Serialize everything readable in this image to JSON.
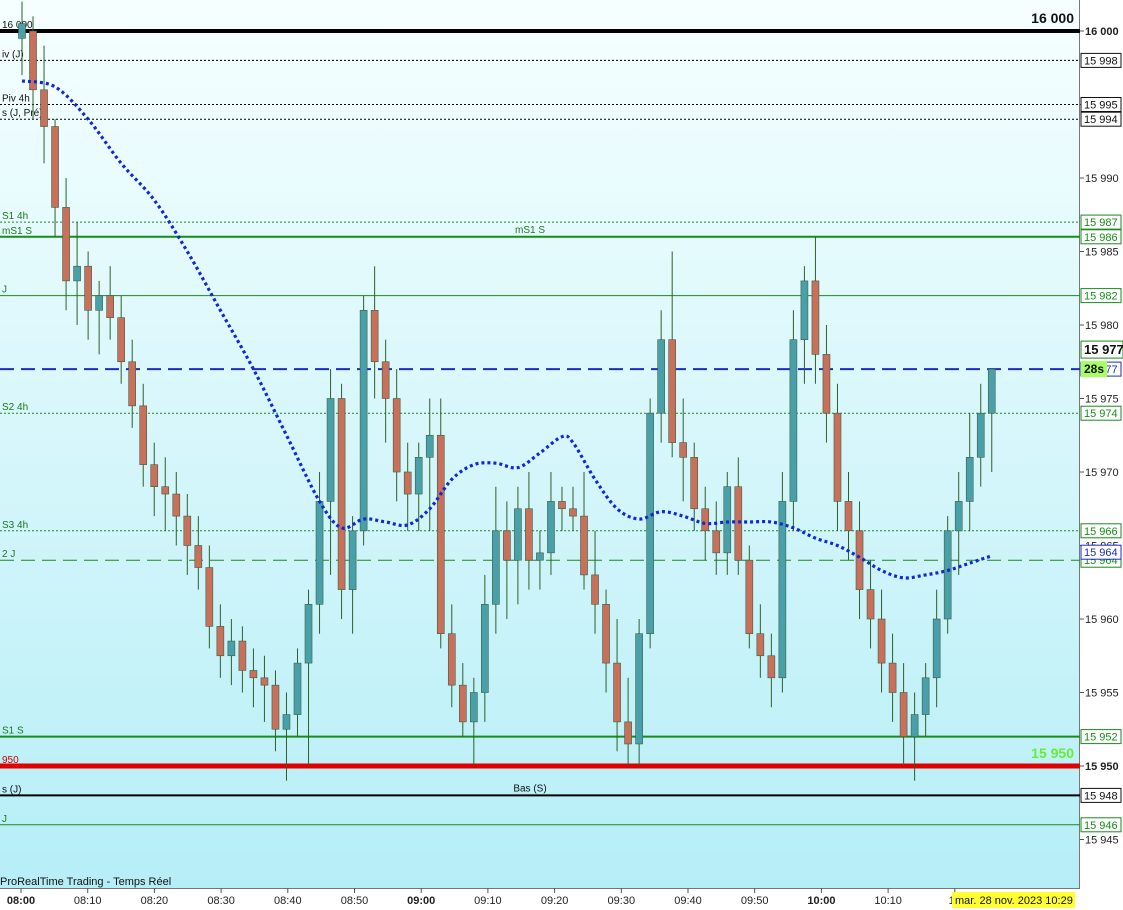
{
  "chart_data": {
    "type": "candlestick",
    "watermark": "ProRealTime Trading - Temps Réel",
    "date_stamp": "mar. 28 nov. 2023 10:29",
    "countdown": "28s",
    "ylim": [
      15941,
      16002
    ],
    "x_ticks": [
      {
        "label": "08:00",
        "bold": true
      },
      {
        "label": "08:10"
      },
      {
        "label": "08:20"
      },
      {
        "label": "08:30"
      },
      {
        "label": "08:40"
      },
      {
        "label": "08:50"
      },
      {
        "label": "09:00",
        "bold": true
      },
      {
        "label": "09:10"
      },
      {
        "label": "09:20"
      },
      {
        "label": "09:30"
      },
      {
        "label": "09:40"
      },
      {
        "label": "09:50"
      },
      {
        "label": "10:00",
        "bold": true
      },
      {
        "label": "10:10"
      },
      {
        "label": "10"
      }
    ],
    "y_ticks": [
      "15 945",
      "15 950",
      "15 955",
      "15 960",
      "15 965",
      "15 970",
      "15 975",
      "15 980",
      "15 985",
      "15 990",
      "15 995",
      "16 000"
    ],
    "y_tick_values": [
      15945,
      15950,
      15955,
      15960,
      15965,
      15970,
      15975,
      15980,
      15985,
      15990,
      15995,
      16000
    ],
    "levels": [
      {
        "value": 16000,
        "label": "16 000",
        "color": "#000000",
        "badge": "16 000",
        "big_label": "16 000",
        "style": "solid",
        "weight": 4
      },
      {
        "value": 15998,
        "label": "iv (J)",
        "color": "#000000",
        "badge": "15 998",
        "style": "dotted",
        "weight": 1
      },
      {
        "value": 15995,
        "label": "Piv 4h",
        "color": "#000000",
        "badge": "15 995",
        "style": "dotted",
        "weight": 1
      },
      {
        "value": 15994,
        "label": "s (J, Pré)",
        "color": "#000000",
        "badge": "15 994",
        "style": "dotted",
        "weight": 1
      },
      {
        "value": 15987,
        "label": "S1 4h",
        "color": "#1a8a1a",
        "badge": "15 987",
        "style": "dotted",
        "weight": 1
      },
      {
        "value": 15986,
        "label": "mS1 S",
        "color": "#1a8a1a",
        "badge": "15 986",
        "style": "solid",
        "weight": 2
      },
      {
        "value": 15982,
        "label": "J",
        "color": "#1a8a1a",
        "badge": "15 982",
        "style": "solid",
        "weight": 1
      },
      {
        "value": 15977,
        "label": "",
        "color": "#1a2ec0",
        "badge": "15 977",
        "style": "dashed",
        "weight": 2
      },
      {
        "value": 15974,
        "label": "S2 4h",
        "color": "#1a8a1a",
        "badge": "15 974",
        "style": "dotted",
        "weight": 1
      },
      {
        "value": 15966,
        "label": "S3 4h",
        "color": "#1a8a1a",
        "badge": "15 966",
        "style": "dotted",
        "weight": 1
      },
      {
        "value": 15964,
        "label": "2 J",
        "color": "#1a8a1a",
        "badge": "15 964",
        "style": "dashed",
        "weight": 1
      },
      {
        "value": 15952,
        "label": "S1 S",
        "color": "#1a8a1a",
        "badge": "15 952",
        "style": "solid",
        "weight": 2
      },
      {
        "value": 15950,
        "label": "950",
        "color": "#e00000",
        "badge": "15 950",
        "big_label": "15 950",
        "style": "solid",
        "weight": 5
      },
      {
        "value": 15948,
        "label": "s (J)",
        "color": "#000000",
        "badge": "15 948",
        "style": "solid",
        "weight": 2
      },
      {
        "value": 15946,
        "label": "J",
        "color": "#1a8a1a",
        "badge": "15 946",
        "style": "solid",
        "weight": 1
      }
    ],
    "extra_labels": [
      {
        "text": "Bas (S)",
        "value": 15948
      },
      {
        "text": "mS1 S",
        "value": 15986
      }
    ],
    "current_price": {
      "value": 15977,
      "label": "15 977"
    },
    "ma_badge": {
      "value": 15964,
      "label": "15 964"
    },
    "candles": [
      {
        "o": 15999.5,
        "h": 16002,
        "l": 15997,
        "c": 16000.5
      },
      {
        "o": 16000,
        "h": 16001,
        "l": 15994,
        "c": 15996
      },
      {
        "o": 15996,
        "h": 15999,
        "l": 15991,
        "c": 15993.5
      },
      {
        "o": 15993.5,
        "h": 15994,
        "l": 15986,
        "c": 15988
      },
      {
        "o": 15988,
        "h": 15990,
        "l": 15981,
        "c": 15983
      },
      {
        "o": 15983,
        "h": 15987,
        "l": 15980,
        "c": 15984
      },
      {
        "o": 15984,
        "h": 15985,
        "l": 15979,
        "c": 15981
      },
      {
        "o": 15981,
        "h": 15983,
        "l": 15978,
        "c": 15982
      },
      {
        "o": 15982,
        "h": 15984,
        "l": 15979,
        "c": 15980.5
      },
      {
        "o": 15980.5,
        "h": 15982,
        "l": 15976,
        "c": 15977.5
      },
      {
        "o": 15977.5,
        "h": 15979,
        "l": 15973,
        "c": 15974.5
      },
      {
        "o": 15974.5,
        "h": 15976,
        "l": 15969,
        "c": 15970.5
      },
      {
        "o": 15970.5,
        "h": 15972,
        "l": 15967,
        "c": 15969
      },
      {
        "o": 15969,
        "h": 15971,
        "l": 15966,
        "c": 15968.5
      },
      {
        "o": 15968.5,
        "h": 15970,
        "l": 15965,
        "c": 15967
      },
      {
        "o": 15967,
        "h": 15968.5,
        "l": 15963,
        "c": 15965
      },
      {
        "o": 15965,
        "h": 15967,
        "l": 15962,
        "c": 15963.5
      },
      {
        "o": 15963.5,
        "h": 15965,
        "l": 15958,
        "c": 15959.5
      },
      {
        "o": 15959.5,
        "h": 15961,
        "l": 15956,
        "c": 15957.5
      },
      {
        "o": 15957.5,
        "h": 15960,
        "l": 15955.5,
        "c": 15958.5
      },
      {
        "o": 15958.5,
        "h": 15959.5,
        "l": 15955,
        "c": 15956.5
      },
      {
        "o": 15956.5,
        "h": 15958,
        "l": 15954,
        "c": 15956
      },
      {
        "o": 15956,
        "h": 15957.5,
        "l": 15953,
        "c": 15955.5
      },
      {
        "o": 15955.5,
        "h": 15956.5,
        "l": 15951,
        "c": 15952.5
      },
      {
        "o": 15952.5,
        "h": 15955,
        "l": 15949,
        "c": 15953.5
      },
      {
        "o": 15953.5,
        "h": 15958,
        "l": 15952,
        "c": 15957
      },
      {
        "o": 15957,
        "h": 15962,
        "l": 15950,
        "c": 15961
      },
      {
        "o": 15961,
        "h": 15970,
        "l": 15959,
        "c": 15968
      },
      {
        "o": 15968,
        "h": 15977,
        "l": 15963,
        "c": 15975
      },
      {
        "o": 15975,
        "h": 15976,
        "l": 15960,
        "c": 15962
      },
      {
        "o": 15962,
        "h": 15967,
        "l": 15959,
        "c": 15966
      },
      {
        "o": 15966,
        "h": 15982,
        "l": 15965,
        "c": 15981
      },
      {
        "o": 15981,
        "h": 15984,
        "l": 15975,
        "c": 15977.5
      },
      {
        "o": 15977.5,
        "h": 15979,
        "l": 15972,
        "c": 15975
      },
      {
        "o": 15975,
        "h": 15977,
        "l": 15968,
        "c": 15970
      },
      {
        "o": 15970,
        "h": 15972,
        "l": 15966,
        "c": 15968.5
      },
      {
        "o": 15968.5,
        "h": 15972,
        "l": 15966,
        "c": 15971
      },
      {
        "o": 15971,
        "h": 15975,
        "l": 15966,
        "c": 15972.5
      },
      {
        "o": 15972.5,
        "h": 15975,
        "l": 15958,
        "c": 15959
      },
      {
        "o": 15959,
        "h": 15961,
        "l": 15954,
        "c": 15955.5
      },
      {
        "o": 15955.5,
        "h": 15957,
        "l": 15952,
        "c": 15953
      },
      {
        "o": 15953,
        "h": 15956,
        "l": 15950,
        "c": 15955
      },
      {
        "o": 15955,
        "h": 15963,
        "l": 15953,
        "c": 15961
      },
      {
        "o": 15961,
        "h": 15969,
        "l": 15959,
        "c": 15966
      },
      {
        "o": 15966,
        "h": 15968,
        "l": 15960,
        "c": 15964
      },
      {
        "o": 15964,
        "h": 15969,
        "l": 15961,
        "c": 15967.5
      },
      {
        "o": 15967.5,
        "h": 15970,
        "l": 15962,
        "c": 15964
      },
      {
        "o": 15964,
        "h": 15966,
        "l": 15962,
        "c": 15964.5
      },
      {
        "o": 15964.5,
        "h": 15970,
        "l": 15963,
        "c": 15968
      },
      {
        "o": 15968,
        "h": 15969,
        "l": 15966,
        "c": 15967.5
      },
      {
        "o": 15967.5,
        "h": 15969,
        "l": 15966,
        "c": 15967
      },
      {
        "o": 15967,
        "h": 15970,
        "l": 15962,
        "c": 15963
      },
      {
        "o": 15963,
        "h": 15966,
        "l": 15959,
        "c": 15961
      },
      {
        "o": 15961,
        "h": 15962,
        "l": 15955,
        "c": 15957
      },
      {
        "o": 15957,
        "h": 15960,
        "l": 15951,
        "c": 15953
      },
      {
        "o": 15953,
        "h": 15956,
        "l": 15950,
        "c": 15951.5
      },
      {
        "o": 15951.5,
        "h": 15960,
        "l": 15950,
        "c": 15959
      },
      {
        "o": 15959,
        "h": 15975,
        "l": 15958,
        "c": 15974
      },
      {
        "o": 15974,
        "h": 15981,
        "l": 15972,
        "c": 15979
      },
      {
        "o": 15979,
        "h": 15985,
        "l": 15971,
        "c": 15972
      },
      {
        "o": 15972,
        "h": 15975,
        "l": 15968,
        "c": 15971
      },
      {
        "o": 15971,
        "h": 15972,
        "l": 15966,
        "c": 15967.5
      },
      {
        "o": 15967.5,
        "h": 15969,
        "l": 15964,
        "c": 15966
      },
      {
        "o": 15966,
        "h": 15968,
        "l": 15963,
        "c": 15964.5
      },
      {
        "o": 15964.5,
        "h": 15970,
        "l": 15963,
        "c": 15969
      },
      {
        "o": 15969,
        "h": 15971,
        "l": 15963,
        "c": 15964
      },
      {
        "o": 15964,
        "h": 15965,
        "l": 15958,
        "c": 15959
      },
      {
        "o": 15959,
        "h": 15961,
        "l": 15956,
        "c": 15957.5
      },
      {
        "o": 15957.5,
        "h": 15959,
        "l": 15954,
        "c": 15956
      },
      {
        "o": 15956,
        "h": 15970,
        "l": 15955,
        "c": 15968
      },
      {
        "o": 15968,
        "h": 15981,
        "l": 15966,
        "c": 15979
      },
      {
        "o": 15979,
        "h": 15984,
        "l": 15976,
        "c": 15983
      },
      {
        "o": 15983,
        "h": 15986,
        "l": 15976,
        "c": 15978
      },
      {
        "o": 15978,
        "h": 15980,
        "l": 15972,
        "c": 15974
      },
      {
        "o": 15974,
        "h": 15976,
        "l": 15966,
        "c": 15968
      },
      {
        "o": 15968,
        "h": 15970,
        "l": 15964,
        "c": 15966
      },
      {
        "o": 15966,
        "h": 15968,
        "l": 15960,
        "c": 15962
      },
      {
        "o": 15962,
        "h": 15964,
        "l": 15958,
        "c": 15960
      },
      {
        "o": 15960,
        "h": 15962,
        "l": 15955,
        "c": 15957
      },
      {
        "o": 15957,
        "h": 15959,
        "l": 15953,
        "c": 15955
      },
      {
        "o": 15955,
        "h": 15957,
        "l": 15950,
        "c": 15952
      },
      {
        "o": 15952,
        "h": 15955,
        "l": 15949,
        "c": 15953.5
      },
      {
        "o": 15953.5,
        "h": 15957,
        "l": 15952,
        "c": 15956
      },
      {
        "o": 15956,
        "h": 15962,
        "l": 15954,
        "c": 15960
      },
      {
        "o": 15960,
        "h": 15967,
        "l": 15959,
        "c": 15966
      },
      {
        "o": 15966,
        "h": 15970,
        "l": 15963,
        "c": 15968
      },
      {
        "o": 15968,
        "h": 15974,
        "l": 15966,
        "c": 15971
      },
      {
        "o": 15971,
        "h": 15976,
        "l": 15969,
        "c": 15974
      },
      {
        "o": 15974,
        "h": 15977,
        "l": 15970,
        "c": 15977
      }
    ],
    "ma_line": [
      {
        "i": 0,
        "v": 15996.6
      },
      {
        "i": 3,
        "v": 15996.2
      },
      {
        "i": 6,
        "v": 15994
      },
      {
        "i": 9,
        "v": 15991
      },
      {
        "i": 12,
        "v": 15988.5
      },
      {
        "i": 15,
        "v": 15985
      },
      {
        "i": 18,
        "v": 15981
      },
      {
        "i": 21,
        "v": 15977
      },
      {
        "i": 24,
        "v": 15972.5
      },
      {
        "i": 27,
        "v": 15968
      },
      {
        "i": 29,
        "v": 15966.2
      },
      {
        "i": 31,
        "v": 15966.8
      },
      {
        "i": 33,
        "v": 15966.6
      },
      {
        "i": 35,
        "v": 15966.4
      },
      {
        "i": 37,
        "v": 15967.5
      },
      {
        "i": 39,
        "v": 15969.5
      },
      {
        "i": 41,
        "v": 15970.5
      },
      {
        "i": 43,
        "v": 15970.6
      },
      {
        "i": 45,
        "v": 15970.3
      },
      {
        "i": 47,
        "v": 15971.3
      },
      {
        "i": 49,
        "v": 15972.4
      },
      {
        "i": 50,
        "v": 15972
      },
      {
        "i": 52,
        "v": 15969.5
      },
      {
        "i": 54,
        "v": 15967.5
      },
      {
        "i": 56,
        "v": 15966.8
      },
      {
        "i": 58,
        "v": 15967.3
      },
      {
        "i": 60,
        "v": 15967
      },
      {
        "i": 62,
        "v": 15966.5
      },
      {
        "i": 64,
        "v": 15966.6
      },
      {
        "i": 66,
        "v": 15966.6
      },
      {
        "i": 68,
        "v": 15966.6
      },
      {
        "i": 70,
        "v": 15966.2
      },
      {
        "i": 72,
        "v": 15965.5
      },
      {
        "i": 74,
        "v": 15965
      },
      {
        "i": 76,
        "v": 15964.2
      },
      {
        "i": 78,
        "v": 15963.3
      },
      {
        "i": 80,
        "v": 15962.8
      },
      {
        "i": 82,
        "v": 15963
      },
      {
        "i": 84,
        "v": 15963.3
      },
      {
        "i": 86,
        "v": 15963.8
      },
      {
        "i": 88,
        "v": 15964.3
      }
    ],
    "colors": {
      "up": "#4aa0a8",
      "down": "#c8705a",
      "wick": "#2f5f2a",
      "ma": "#1028d8",
      "bg_top": "#f6ffff",
      "bg_bottom": "#b6eef7"
    }
  }
}
